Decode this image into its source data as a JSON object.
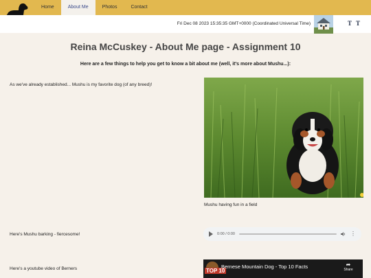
{
  "nav": {
    "items": [
      {
        "label": "Home"
      },
      {
        "label": "About Me"
      },
      {
        "label": "Photos"
      },
      {
        "label": "Contact"
      }
    ],
    "active_index": 1
  },
  "header": {
    "datetime": "Fri Dec 08 2023 15:35:35 GMT+0000 (Coordinated Universal Time)",
    "font_buttons": [
      "T",
      "T"
    ]
  },
  "main": {
    "title": "Reina McCuskey - About Me page - Assignment 10",
    "subtitle": "Here are a few things to help you get to know a bit about me (well, it's more about Mushu...):",
    "row1_text": "As we've already established... Mushu is my favorite dog (of any breed)!",
    "photo_caption": "Mushu having fun in a field",
    "row2_text": "Here's Mushu barking - fiercesome!",
    "audio_time": "0:00 / 0:00",
    "row3_text": "Here's a youtube video of Berners",
    "video_title": "Bernese Mountain Dog - Top 10 Facts",
    "video_badge": "TOP 10",
    "video_share_label": "Share"
  },
  "colors": {
    "topbar": "#e2b84f",
    "background": "#f6f1ea",
    "active_tab_text": "#3a4a8a"
  }
}
